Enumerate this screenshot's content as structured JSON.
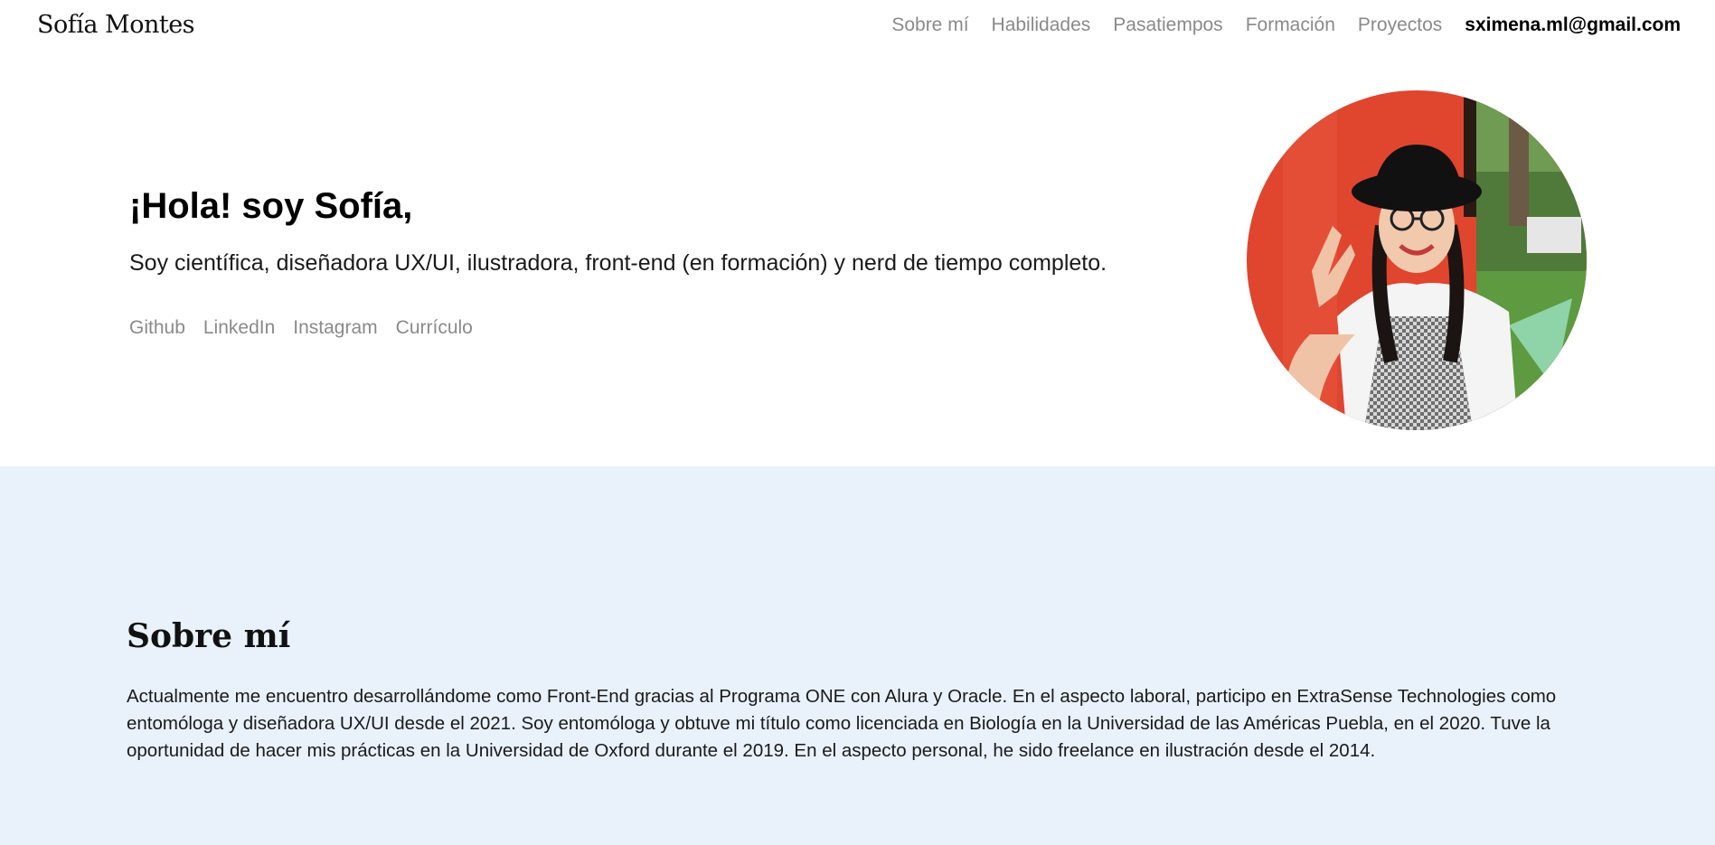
{
  "header": {
    "brand": "Sofía Montes",
    "nav": {
      "about": "Sobre mí",
      "skills": "Habilidades",
      "hobbies": "Pasatiempos",
      "education": "Formación",
      "projects": "Proyectos",
      "email": "sximena.ml@gmail.com"
    }
  },
  "hero": {
    "title": "¡Hola! soy Sofía,",
    "subtitle": "Soy científica, diseñadora UX/UI, ilustradora, front-end (en formación) y nerd de tiempo completo.",
    "links": {
      "github": "Github",
      "linkedin": "LinkedIn",
      "instagram": "Instagram",
      "cv": "Currículo"
    }
  },
  "about": {
    "title": "Sobre mí",
    "text": "Actualmente me encuentro desarrollándome como Front-End gracias al Programa ONE con Alura y Oracle. En el aspecto laboral, participo en ExtraSense Technologies como entomóloga y diseñadora UX/UI desde el 2021. Soy entomóloga y obtuve mi título como licenciada en Biología en la Universidad de las Américas Puebla, en el 2020. Tuve la oportunidad de hacer mis prácticas en la Universidad de Oxford durante el 2019. En el aspecto personal, he sido freelance en ilustración desde el 2014."
  },
  "colors": {
    "nav_link": "#8a8a8a",
    "about_bg": "#e9f1fb",
    "text": "#1a1a1a"
  }
}
